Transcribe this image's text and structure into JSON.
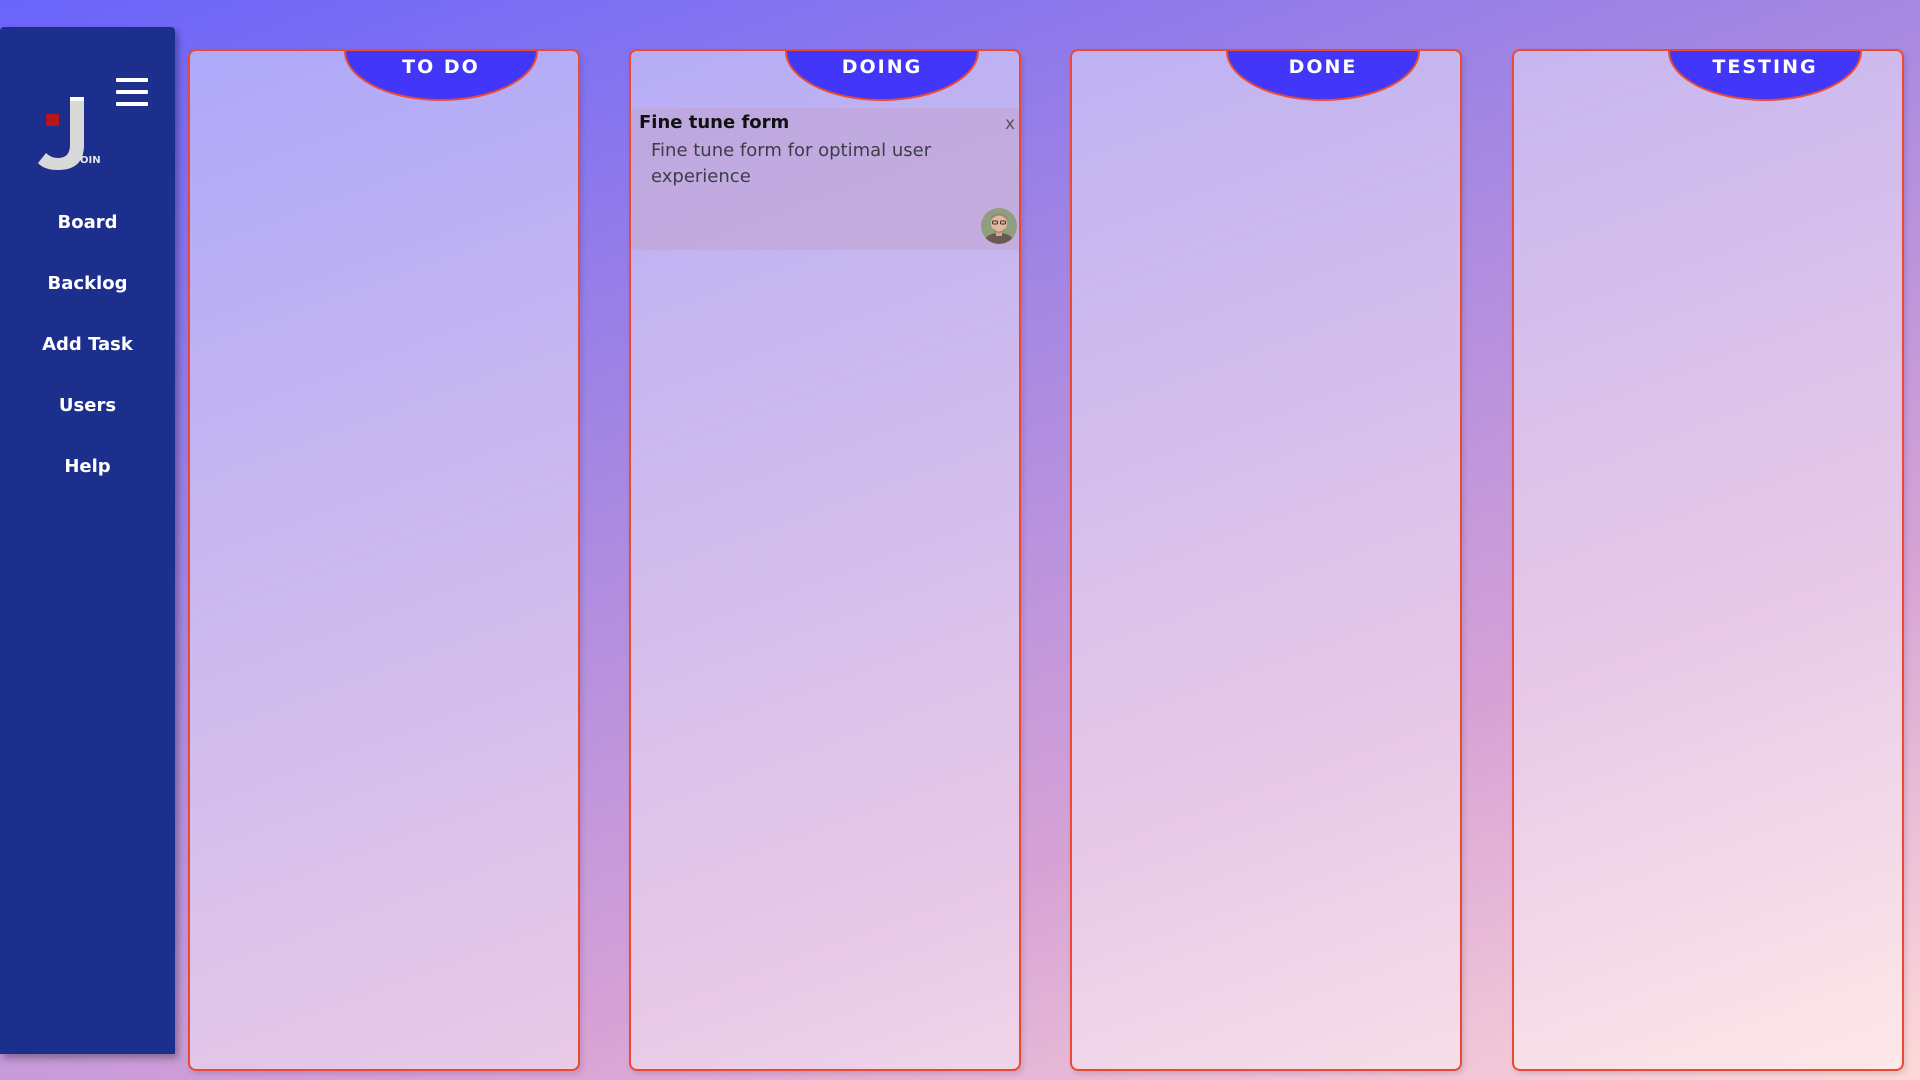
{
  "sidebar": {
    "logo_text": "OIN",
    "nav": [
      {
        "label": "Board"
      },
      {
        "label": "Backlog"
      },
      {
        "label": "Add Task"
      },
      {
        "label": "Users"
      },
      {
        "label": "Help"
      }
    ]
  },
  "board": {
    "columns": [
      {
        "title": "TO DO"
      },
      {
        "title": "DOING"
      },
      {
        "title": "DONE"
      },
      {
        "title": "TESTING"
      }
    ],
    "tasks": [
      {
        "column": "DOING",
        "title": "Fine tune form",
        "description": "Fine tune form for optimal user experience",
        "close_label": "x"
      }
    ]
  },
  "colors": {
    "sidebar": "#1c2f8c",
    "column_header": "#4236f8",
    "column_border": "#ea4a31",
    "logo_accent": "#b5151c"
  },
  "icons": {
    "menu": "hamburger-menu-icon",
    "close": "close-icon",
    "avatar": "user-avatar"
  }
}
